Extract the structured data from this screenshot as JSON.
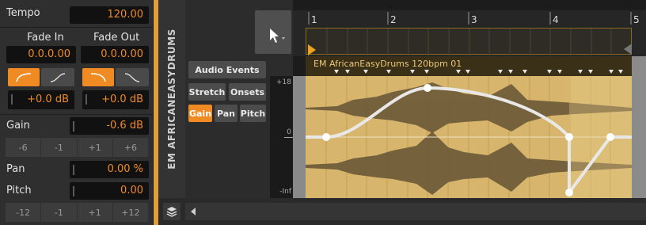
{
  "inspector": {
    "tempo_label": "Tempo",
    "tempo_value": "120.00",
    "fade_in_label": "Fade In",
    "fade_out_label": "Fade Out",
    "fade_in_value": "0.0.0.00",
    "fade_out_value": "0.0.0.00",
    "fade_in_db": "+0.0 dB",
    "fade_out_db": "+0.0 dB",
    "gain_label": "Gain",
    "gain_value": "-0.6 dB",
    "gain_steps": [
      "-6",
      "-1",
      "+1",
      "+6"
    ],
    "pan_label": "Pan",
    "pan_value": "0.00 %",
    "pitch_label": "Pitch",
    "pitch_value": "0.00",
    "pitch_steps": [
      "-12",
      "-1",
      "+1",
      "+12"
    ]
  },
  "track": {
    "name": "EM AFRICANEASYDRUMS"
  },
  "editor": {
    "audio_events_label": "Audio Events",
    "stretch_label": "Stretch",
    "onsets_label": "Onsets",
    "gain_tab": "Gain",
    "pan_tab": "Pan",
    "pitch_tab": "Pitch",
    "scale_top": "+18",
    "scale_mid": "0",
    "scale_bottom": "-Inf"
  },
  "timeline": {
    "bars": [
      "1",
      "2",
      "3",
      "4",
      "5"
    ]
  },
  "clip": {
    "name": "EM AfricanEasyDrums 120bpm 01"
  },
  "colors": {
    "accent": "#f08a22",
    "clip": "#d7b56c",
    "track": "#e39e3c"
  }
}
